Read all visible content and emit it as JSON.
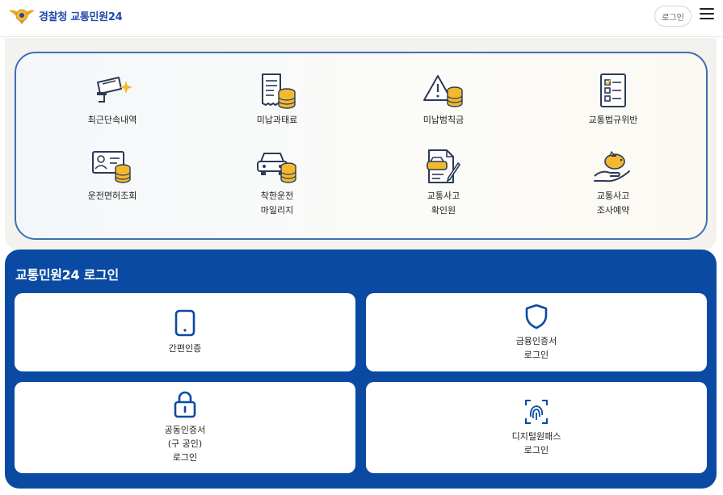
{
  "header": {
    "logo_text": "경찰청 교통민원24",
    "login_label": "로그인"
  },
  "services": [
    {
      "label": "최근단속내역",
      "icon": "camera-sparkle-icon"
    },
    {
      "label": "미납과태료",
      "icon": "receipt-coins-icon"
    },
    {
      "label": "미납범칙금",
      "icon": "warning-coins-icon"
    },
    {
      "label": "교통법규위반",
      "icon": "checklist-icon"
    },
    {
      "label": "운전면허조회",
      "icon": "license-card-coins-icon"
    },
    {
      "label": "착한운전\n마일리지",
      "icon": "car-coins-icon"
    },
    {
      "label": "교통사고\n확인원",
      "icon": "accident-document-icon"
    },
    {
      "label": "교통사고\n조사예약",
      "icon": "piggy-hand-icon"
    }
  ],
  "login": {
    "title": "교통민원24 로그인",
    "options": [
      {
        "label": "간편인증",
        "icon": "phone-icon"
      },
      {
        "label": "금융인증서\n로그인",
        "icon": "shield-icon"
      },
      {
        "label": "공동인증서\n(구 공인)\n로그인",
        "icon": "lock-icon"
      },
      {
        "label": "디지털원패스\n로그인",
        "icon": "fingerprint-icon"
      }
    ]
  },
  "colors": {
    "brand_blue": "#0b4aa2",
    "card_border": "#3f6eb4",
    "coin_gold": "#f2b92e",
    "icon_navy": "#2c3a57"
  }
}
